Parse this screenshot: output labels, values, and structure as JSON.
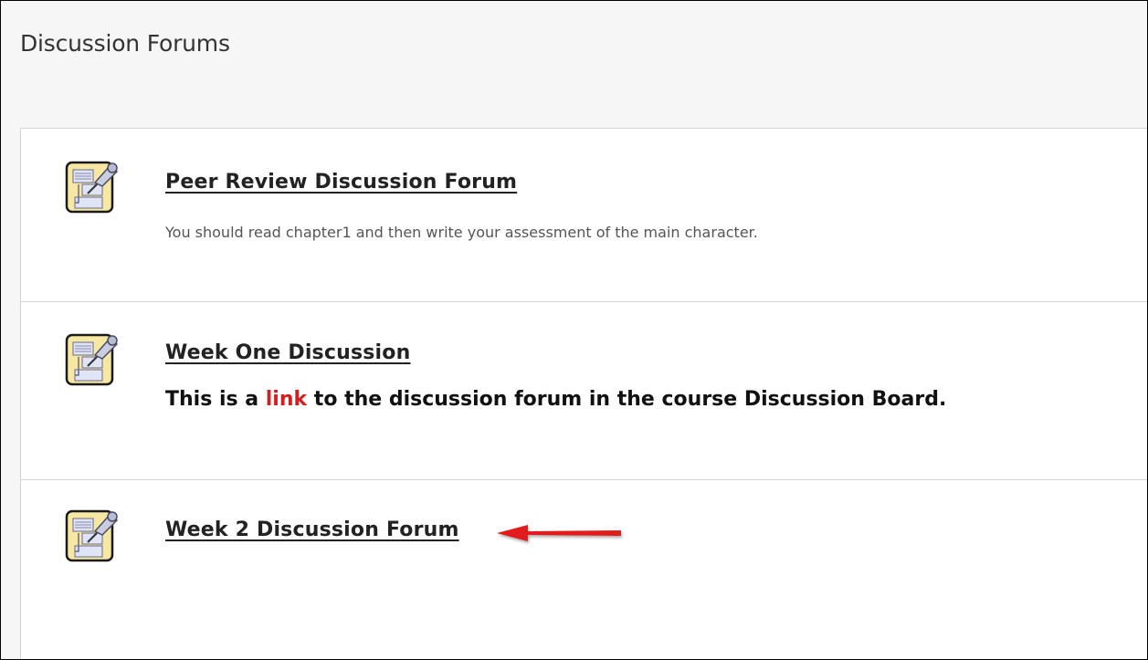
{
  "page": {
    "title": "Discussion Forums"
  },
  "forums": [
    {
      "title": "Peer Review Discussion Forum",
      "description": "You should read chapter1 and then write your assessment of the main character."
    },
    {
      "title": "Week One Discussion",
      "description_prefix": "This is a ",
      "description_link": "link",
      "description_suffix": " to the discussion forum in the course Discussion Board."
    },
    {
      "title": "Week 2 Discussion Forum"
    }
  ],
  "icons": {
    "forum": "discussion-forum-icon",
    "annotation": "red-arrow-icon"
  },
  "colors": {
    "link_red": "#d21f1f",
    "arrow_red": "#e21b1b"
  }
}
